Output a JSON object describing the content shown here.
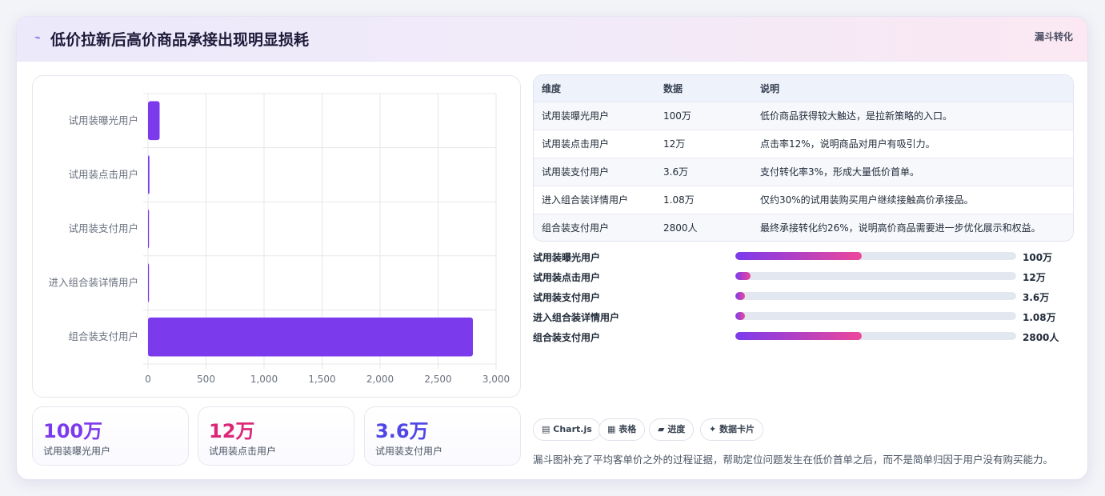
{
  "header": {
    "icon": "trend-line-icon",
    "icon_glyph": "⌁",
    "title": "低价拉新后高价商品承接出现明显损耗",
    "tag": "漏斗转化"
  },
  "chart_data": {
    "type": "bar",
    "orientation": "horizontal",
    "categories": [
      "试用装曝光用户",
      "试用装点击用户",
      "试用装支付用户",
      "进入组合装详情用户",
      "组合装支付用户"
    ],
    "values": [
      100,
      12,
      3.6,
      1.08,
      2800
    ],
    "xlim": [
      0,
      3000
    ],
    "xticks": [
      "0",
      "500",
      "1,000",
      "1,500",
      "2,000",
      "2,500",
      "3,000"
    ],
    "bar_color": "#7c3aed",
    "grid": true,
    "legend": "none"
  },
  "kpis": [
    {
      "value": "100万",
      "label": "试用装曝光用户",
      "color": "#7c3aed"
    },
    {
      "value": "12万",
      "label": "试用装点击用户",
      "color": "#db2777"
    },
    {
      "value": "3.6万",
      "label": "试用装支付用户",
      "color": "#4f46e5"
    }
  ],
  "table": {
    "headers": [
      "维度",
      "数据",
      "说明"
    ],
    "rows": [
      [
        "试用装曝光用户",
        "100万",
        "低价商品获得较大触达，是拉新策略的入口。"
      ],
      [
        "试用装点击用户",
        "12万",
        "点击率12%，说明商品对用户有吸引力。"
      ],
      [
        "试用装支付用户",
        "3.6万",
        "支付转化率3%，形成大量低价首单。"
      ],
      [
        "进入组合装详情用户",
        "1.08万",
        "仅约30%的试用装购买用户继续接触高价承接品。"
      ],
      [
        "组合装支付用户",
        "2800人",
        "最终承接转化约26%，说明高价商品需要进一步优化展示和权益。"
      ]
    ]
  },
  "progress": [
    {
      "label": "试用装曝光用户",
      "value": "100万",
      "fill": 0.45
    },
    {
      "label": "试用装点击用户",
      "value": "12万",
      "fill": 0.055
    },
    {
      "label": "试用装支付用户",
      "value": "3.6万",
      "fill": 0.035
    },
    {
      "label": "进入组合装详情用户",
      "value": "1.08万",
      "fill": 0.035
    },
    {
      "label": "组合装支付用户",
      "value": "2800人",
      "fill": 0.45
    }
  ],
  "chips": [
    {
      "icon": "chart-icon",
      "glyph": "▤",
      "label": "Chart.js"
    },
    {
      "icon": "table-icon",
      "glyph": "▦",
      "label": "表格"
    },
    {
      "icon": "progress-icon",
      "glyph": "▰",
      "label": "进度"
    },
    {
      "icon": "sparkle-icon",
      "glyph": "✦",
      "label": "数据卡片"
    }
  ],
  "note": "漏斗图补充了平均客单价之外的过程证据，帮助定位问题发生在低价首单之后，而不是简单归因于用户没有购买能力。"
}
